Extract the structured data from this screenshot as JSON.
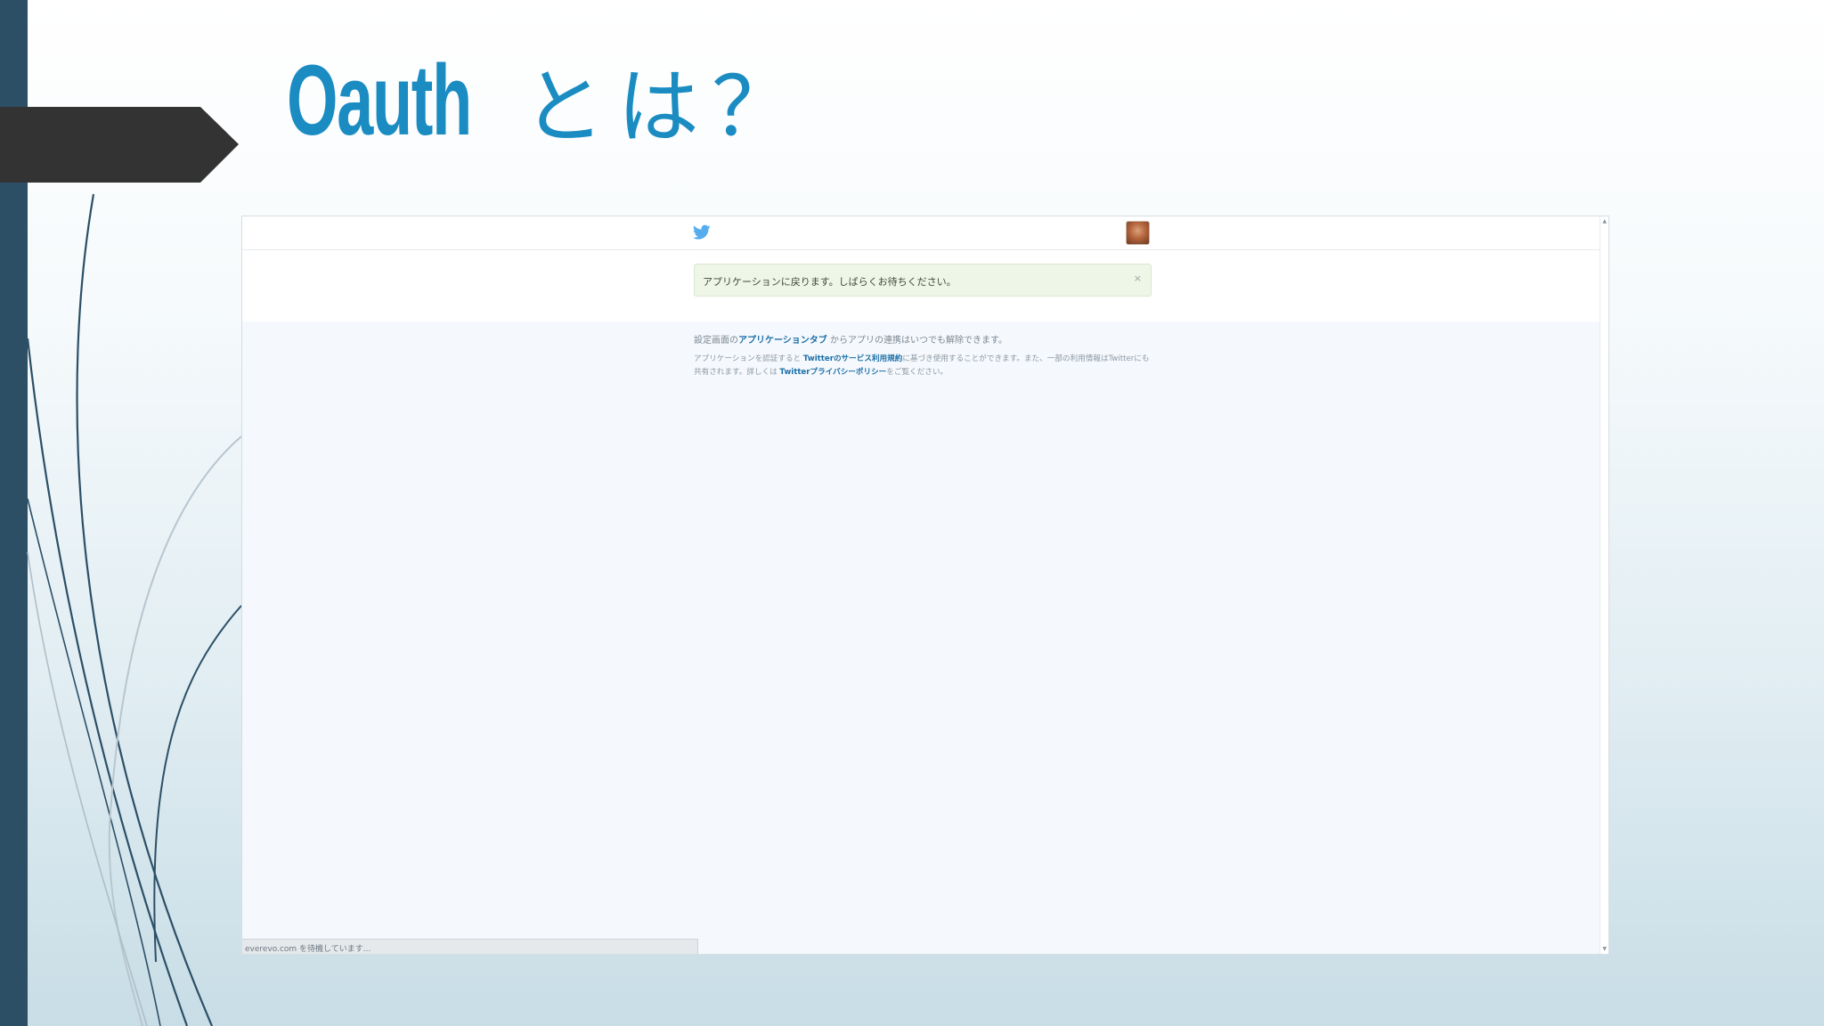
{
  "slide": {
    "title_latin": "Oauth",
    "title_jp": "とは？",
    "colors": {
      "title": "#1a8cc2",
      "left_bar": "#2c4f66",
      "arrow_tab": "#333333"
    }
  },
  "screenshot": {
    "navbar": {
      "logo_icon": "twitter-bird-icon",
      "avatar_icon": "user-avatar"
    },
    "notice": {
      "text": "アプリケーションに戻ります。しばらくお待ちください。",
      "close": "×"
    },
    "info_line1": {
      "prefix": "設定画面の",
      "link": "アプリケーションタブ",
      "suffix": " からアプリの連携はいつでも解除できます。"
    },
    "info_line2": {
      "part1": "アプリケーションを認証すると ",
      "link1": "Twitterのサービス利用規約",
      "part2": "に基づき使用することができます。また、一部の利用情報はTwitterにも共有されます。詳しくは ",
      "link2": "Twitterプライバシーポリシー",
      "part3": "をご覧ください。"
    },
    "status_bar": {
      "text": "everevo.com を待機しています..."
    }
  }
}
